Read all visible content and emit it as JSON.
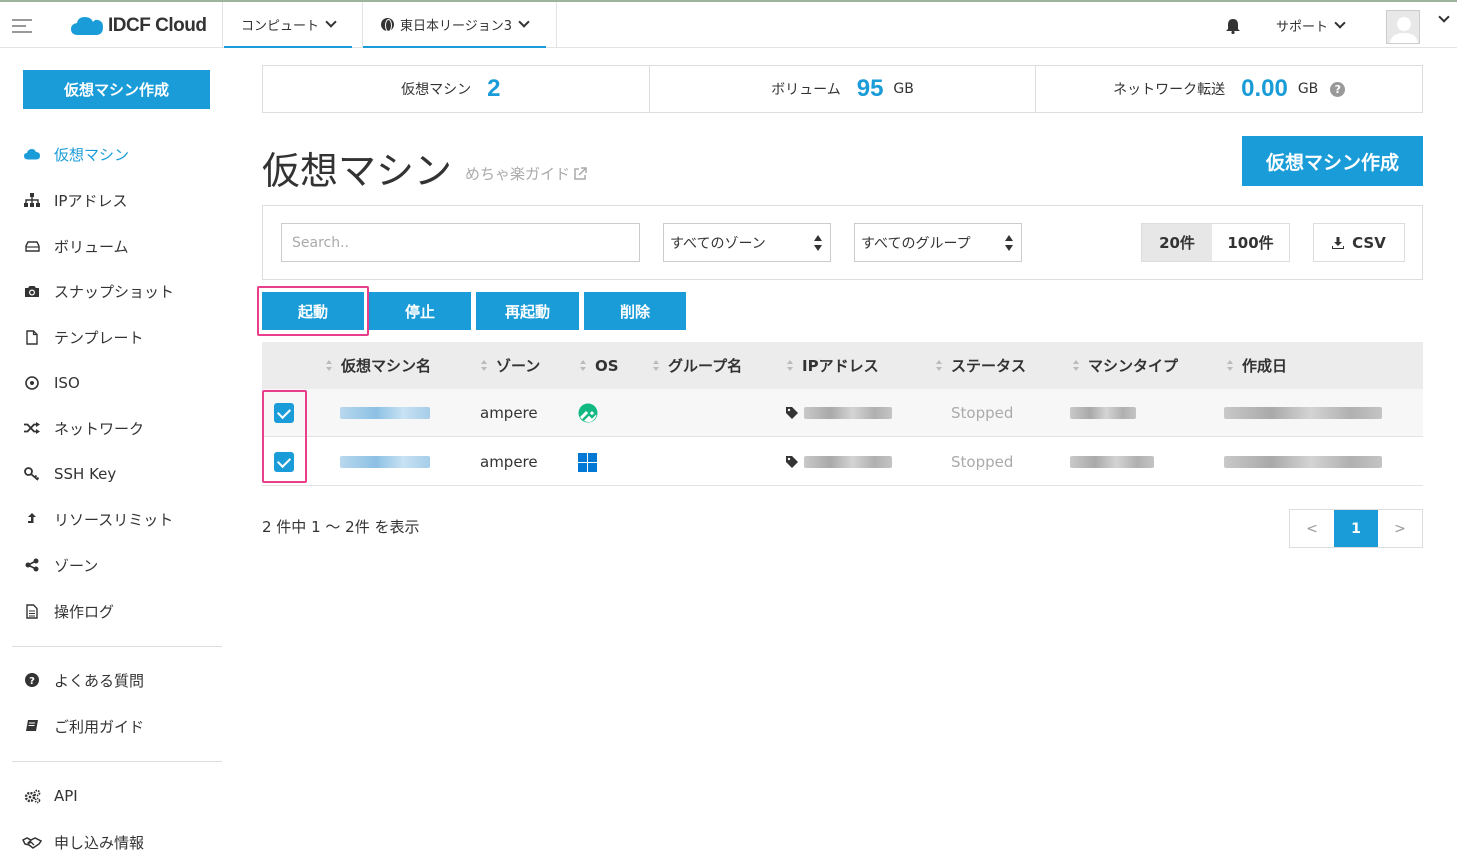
{
  "topbar": {
    "logo": "IDCF Cloud",
    "nav": [
      {
        "label": "コンピュート"
      },
      {
        "label": "東日本リージョン3"
      }
    ],
    "support_label": "サポート"
  },
  "sidebar": {
    "create_label": "仮想マシン作成",
    "items": [
      {
        "label": "仮想マシン",
        "icon": "cloud-icon"
      },
      {
        "label": "IPアドレス",
        "icon": "sitemap-icon"
      },
      {
        "label": "ボリューム",
        "icon": "hdd-icon"
      },
      {
        "label": "スナップショット",
        "icon": "camera-icon"
      },
      {
        "label": "テンプレート",
        "icon": "file-icon"
      },
      {
        "label": "ISO",
        "icon": "disc-icon"
      },
      {
        "label": "ネットワーク",
        "icon": "random-icon"
      },
      {
        "label": "SSH Key",
        "icon": "key-icon"
      },
      {
        "label": "リソースリミット",
        "icon": "upload-icon"
      },
      {
        "label": "ゾーン",
        "icon": "share-icon"
      },
      {
        "label": "操作ログ",
        "icon": "document-icon"
      },
      {
        "label": "よくある質問",
        "icon": "question-circle-icon"
      },
      {
        "label": "ご利用ガイド",
        "icon": "book-icon"
      },
      {
        "label": "API",
        "icon": "cogs-icon"
      },
      {
        "label": "申し込み情報",
        "icon": "handshake-icon"
      }
    ]
  },
  "stats": {
    "vm_label": "仮想マシン",
    "vm_value": "2",
    "volume_label": "ボリューム",
    "volume_value": "95",
    "volume_unit": "GB",
    "network_label": "ネットワーク転送",
    "network_value": "0.00",
    "network_unit": "GB"
  },
  "page": {
    "title": "仮想マシン",
    "guide_link": "めちゃ楽ガイド",
    "create_label": "仮想マシン作成"
  },
  "filter": {
    "search_placeholder": "Search..",
    "zone_select": "すべてのゾーン",
    "group_select": "すべてのグループ",
    "page_sizes": [
      "20件",
      "100件"
    ],
    "csv_label": "CSV"
  },
  "actions": {
    "start": "起動",
    "stop": "停止",
    "restart": "再起動",
    "delete": "削除"
  },
  "table": {
    "headers": [
      "仮想マシン名",
      "ゾーン",
      "OS",
      "グループ名",
      "IPアドレス",
      "ステータス",
      "マシンタイプ",
      "作成日"
    ],
    "rows": [
      {
        "zone": "ampere",
        "os_icon": "rocky-linux-icon",
        "status": "Stopped",
        "checked": true
      },
      {
        "zone": "ampere",
        "os_icon": "windows-icon",
        "status": "Stopped",
        "checked": true
      }
    ]
  },
  "footer": {
    "count_text": "2 件中 1 〜 2件 を表示",
    "prev": "<",
    "current_page": "1",
    "next": ">"
  },
  "colors": {
    "accent": "#1a9cd8",
    "highlight": "#e83e8c"
  }
}
